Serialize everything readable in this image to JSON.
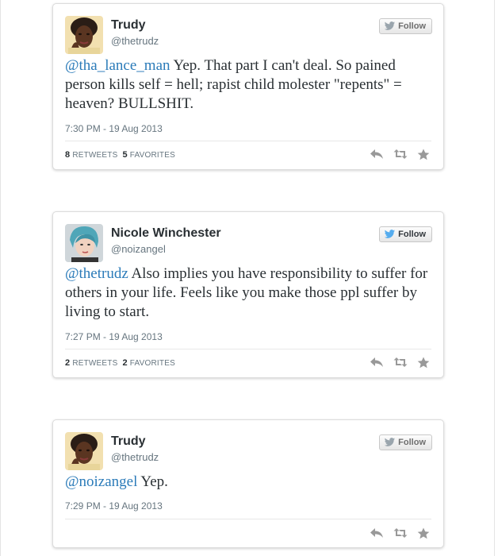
{
  "tweets": [
    {
      "author": "Trudy",
      "handle": "@thetrudz",
      "follow_label": "Follow",
      "mention": "@tha_lance_man",
      "text": " Yep. That part I can't deal. So pained person kills self = hell; rapist child molester \"repents\" = heaven? BULLSHIT.",
      "time": "7:30 PM - 19 Aug 2013",
      "retweets": "8",
      "retweets_label": "RETWEETS",
      "favorites": "5",
      "favorites_label": "FAVORITES"
    },
    {
      "author": "Nicole Winchester",
      "handle": "@noizangel",
      "follow_label": "Follow",
      "mention": "@thetrudz",
      "text": " Also implies you have responsibility to suffer for others in your life. Feels like you make those ppl suffer by living to start.",
      "time": "7:27 PM - 19 Aug 2013",
      "retweets": "2",
      "retweets_label": "RETWEETS",
      "favorites": "2",
      "favorites_label": "FAVORITES"
    },
    {
      "author": "Trudy",
      "handle": "@thetrudz",
      "follow_label": "Follow",
      "mention": "@noizangel",
      "text": " Yep.",
      "time": "7:29 PM - 19 Aug 2013"
    }
  ],
  "colors": {
    "mention": "#2b7bb9",
    "follow_bird_active": "#55acee",
    "follow_bird_inactive": "#9aa5ad",
    "action_icon": "#999999"
  },
  "icons": [
    "reply-icon",
    "retweet-icon",
    "favorite-icon",
    "bird-icon"
  ]
}
